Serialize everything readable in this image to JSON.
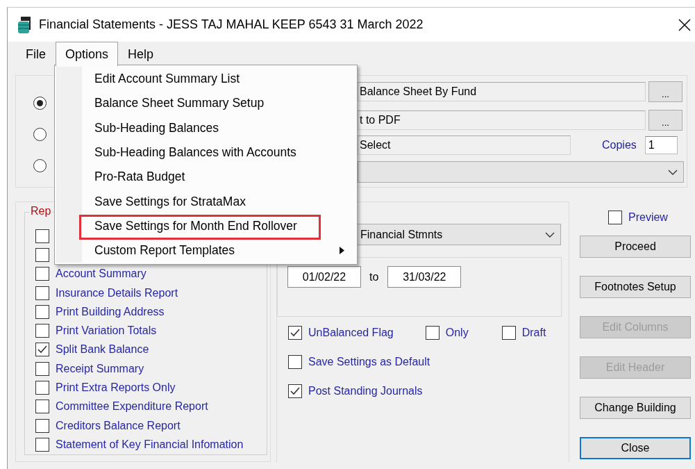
{
  "window": {
    "title": "Financial Statements - JESS TAJ MAHAL KEEP 6543 31 March 2022"
  },
  "menu_bar": [
    {
      "label": "File",
      "selected": false
    },
    {
      "label": "Options",
      "selected": true
    },
    {
      "label": "Help",
      "selected": false
    }
  ],
  "options_menu": {
    "items": [
      {
        "label": "Edit Account Summary List",
        "marked": false,
        "has_submenu": false
      },
      {
        "label": "Balance Sheet Summary Setup",
        "marked": false,
        "has_submenu": false
      },
      {
        "label": "Sub-Heading Balances",
        "marked": false,
        "has_submenu": false
      },
      {
        "label": "Sub-Heading Balances with Accounts",
        "marked": false,
        "has_submenu": false
      },
      {
        "label": "Pro-Rata Budget",
        "marked": false,
        "has_submenu": false
      },
      {
        "label": "Save Settings for StrataMax",
        "marked": false,
        "has_submenu": false
      },
      {
        "label": "Save Settings for Month End Rollover",
        "marked": true,
        "has_submenu": false
      },
      {
        "label": "Custom Report Templates",
        "marked": false,
        "has_submenu": true
      }
    ]
  },
  "report_source": {
    "options": [
      {
        "selected": true
      },
      {
        "selected": false
      },
      {
        "selected": false
      }
    ],
    "report": {
      "value": "Balance Sheet By Fund",
      "browse": "..."
    },
    "output": {
      "value": "t to PDF",
      "browse": "..."
    },
    "printer": {
      "value": "Select"
    },
    "copies": {
      "label": "Copies",
      "value": "1"
    }
  },
  "report_options": {
    "legend": "Rep",
    "items": [
      {
        "checked": false
      },
      {
        "checked": false
      },
      {
        "label": "Account Summary",
        "checked": false
      },
      {
        "label": "Insurance Details Report",
        "checked": false
      },
      {
        "label": "Print Building Address",
        "checked": false
      },
      {
        "label": "Print Variation Totals",
        "checked": false
      },
      {
        "label": "Split Bank Balance",
        "checked": true
      },
      {
        "label": "Receipt Summary",
        "checked": false
      },
      {
        "label": "Print Extra Reports Only",
        "checked": false
      },
      {
        "label": "Committee Expenditure Report",
        "checked": false
      },
      {
        "label": "Creditors Balance Report",
        "checked": false
      },
      {
        "label": "Statement of Key Financial Infomation",
        "checked": false
      }
    ]
  },
  "report_type": {
    "value": "Financial Stmnts"
  },
  "period": {
    "from": "01/02/22",
    "to_label": "to",
    "to": "31/03/22"
  },
  "flags": [
    {
      "label": "UnBalanced Flag",
      "checked": true
    },
    {
      "label": "Only",
      "checked": false
    },
    {
      "label": "Draft",
      "checked": false
    }
  ],
  "settings": [
    {
      "label": "Save Settings as Default",
      "checked": false
    },
    {
      "label": "Post Standing Journals",
      "checked": true
    }
  ],
  "preview": {
    "label": "Preview",
    "checked": false
  },
  "buttons": [
    {
      "label": "Proceed",
      "disabled": false,
      "focused": false
    },
    {
      "label": "Footnotes Setup",
      "disabled": false,
      "focused": false
    },
    {
      "label": "Edit Columns",
      "disabled": true,
      "focused": false
    },
    {
      "label": "Edit Header",
      "disabled": true,
      "focused": false
    },
    {
      "label": "Change Building",
      "disabled": false,
      "focused": false
    },
    {
      "label": "Close",
      "disabled": false,
      "focused": true
    }
  ]
}
